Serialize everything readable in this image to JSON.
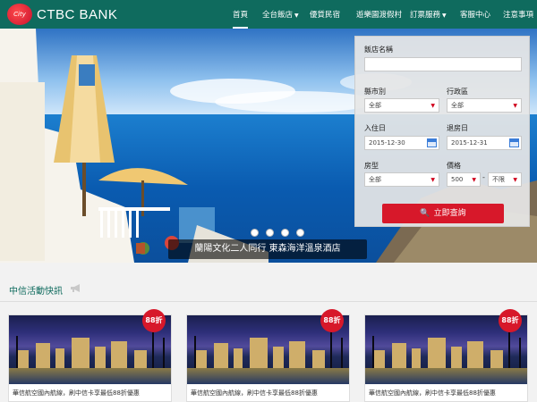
{
  "brand": {
    "name": "CTBC BANK",
    "logo_text": "City"
  },
  "nav": [
    {
      "label": "首頁",
      "active": true,
      "dropdown": false
    },
    {
      "label": "全台飯店",
      "active": false,
      "dropdown": true
    },
    {
      "label": "優質民宿",
      "active": false,
      "dropdown": false
    },
    {
      "label": "遊樂園渡假村",
      "active": false,
      "dropdown": false
    },
    {
      "label": "訂票服務",
      "active": false,
      "dropdown": true
    },
    {
      "label": "客服中心",
      "active": false,
      "dropdown": false
    },
    {
      "label": "注意事項",
      "active": false,
      "dropdown": false
    }
  ],
  "hero": {
    "caption": "蘭陽文化二人同行  東森海洋溫泉酒店",
    "slides": 4,
    "active_slide": 1
  },
  "search": {
    "hotel_name_label": "飯店名稱",
    "hotel_name_value": "",
    "city_label": "縣市別",
    "city_value": "全部",
    "district_label": "行政區",
    "district_value": "全部",
    "checkin_label": "入住日",
    "checkin_value": "2015-12-30",
    "checkout_label": "退房日",
    "checkout_value": "2015-12-31",
    "room_label": "房型",
    "room_value": "全部",
    "price_label": "價格",
    "price_min": "500",
    "price_sep": "-",
    "price_max": "不限",
    "submit_label": "立即查詢"
  },
  "section": {
    "title": "中信活動快訊"
  },
  "cards": [
    {
      "badge": "88折",
      "text": "華信航空國內航線，刷中信卡享最低88折優惠"
    },
    {
      "badge": "88折",
      "text": "華信航空國內航線，刷中信卡享最低88折優惠"
    },
    {
      "badge": "88折",
      "text": "華信航空國內航線，刷中信卡享最低88折優惠"
    }
  ],
  "colors": {
    "header": "#0f6b5e",
    "accent": "#d7182a",
    "section_title": "#0f6b5e"
  }
}
